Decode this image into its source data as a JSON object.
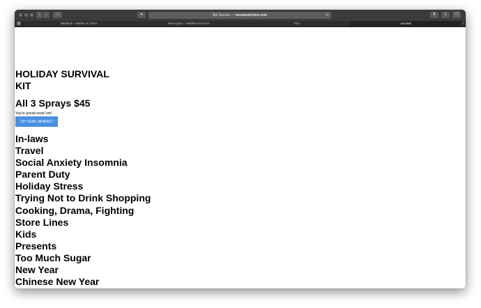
{
  "browser": {
    "back_icon": "chevron-left-icon",
    "forward_icon": "chevron-right-icon",
    "sidebar_icon": "sidebar-icon",
    "privacy_icon": "shield-icon",
    "url_prefix": "Not Secure — ",
    "url_domain": "momandclone.com",
    "reload_glyph": "↻",
    "download_icon": "download-icon",
    "share_icon": "share-icon",
    "tabs_icon": "tabs-icon",
    "tabs": [
      {
        "label": "Webflow - Mother & Clone",
        "active": false
      },
      {
        "label": "New topics - Webflow Forums",
        "active": false
      },
      {
        "label": "Flex",
        "active": false
      },
      {
        "label": "survival",
        "active": true
      }
    ]
  },
  "page": {
    "title": "HOLIDAY SURVIVAL KIT",
    "price": "All 3 Sprays $45",
    "tagline": "You're gonna need 'em!",
    "cta_label": "OH YEAH, WHERE?",
    "cta_color": "#4a90e2",
    "occasions": [
      "In-laws",
      "Travel",
      "Social Anxiety Insomnia",
      "Parent Duty",
      "Holiday Stress",
      "Trying Not to Drink Shopping",
      "Cooking, Drama, Fighting",
      "Store Lines",
      "Kids",
      "Presents",
      "Too Much Sugar",
      "New Year",
      "Chinese New Year"
    ]
  }
}
